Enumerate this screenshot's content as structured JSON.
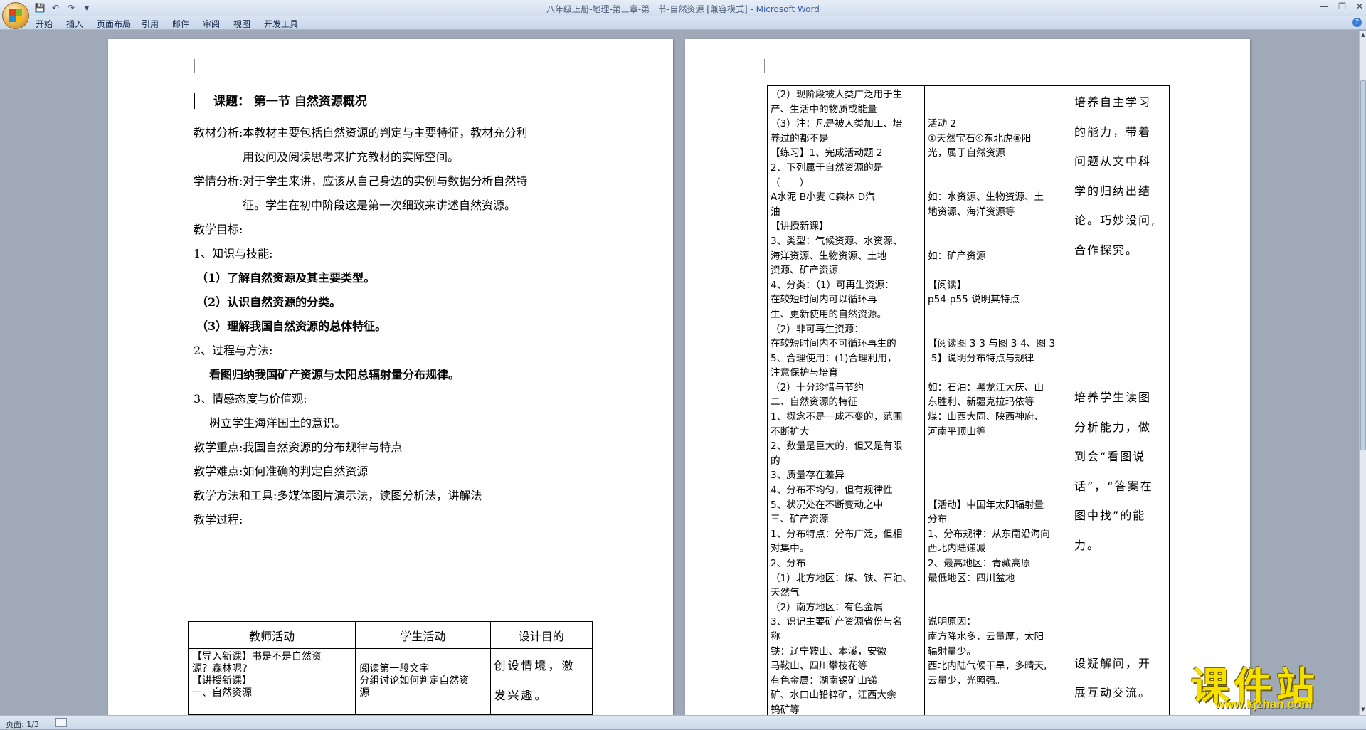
{
  "window": {
    "title": "八年级上册-地理-第三章-第一节-自然资源 [兼容模式]",
    "app_name": "Microsoft Word",
    "title_separator": " - "
  },
  "ribbon": {
    "tabs": [
      "开始",
      "插入",
      "页面布局",
      "引用",
      "邮件",
      "审阅",
      "视图",
      "开发工具"
    ]
  },
  "page1": {
    "title": "课题：  第一节  自然资源概况",
    "lines": [
      {
        "text": "教材分析:本教材主要包括自然资源的判定与主要特征，教材充分利",
        "bold": false
      },
      {
        "text": "用设问及阅读思考来扩充教材的实际空间。",
        "bold": false
      },
      {
        "text": "学情分析:对于学生来讲，应该从自己身边的实例与数据分析自然特",
        "bold": false
      },
      {
        "text": "征。学生在初中阶段这是第一次细致来讲述自然资源。",
        "bold": false
      },
      {
        "text": "教学目标:",
        "bold": false
      },
      {
        "text": "1、知识与技能:",
        "bold": false
      },
      {
        "text": "（1）了解自然资源及其主要类型。",
        "bold": true
      },
      {
        "text": "（2）认识自然资源的分类。",
        "bold": true
      },
      {
        "text": "（3）理解我国自然资源的总体特征。",
        "bold": true
      },
      {
        "text": "2、过程与方法:",
        "bold": false
      },
      {
        "text": "看图归纳我国矿产资源与太阳总辐射量分布规律。",
        "bold": true
      },
      {
        "text": "3、情感态度与价值观:",
        "bold": false
      },
      {
        "text": "树立学生海洋国土的意识。",
        "bold": false
      },
      {
        "text": "教学重点:我国自然资源的分布规律与特点",
        "bold": false
      },
      {
        "text": "教学难点:如何准确的判定自然资源",
        "bold": false
      },
      {
        "text": "教学方法和工具:多媒体图片演示法，读图分析法，讲解法",
        "bold": false
      },
      {
        "text": "教学过程:",
        "bold": false
      }
    ],
    "table": {
      "headers": [
        "教师活动",
        "学生活动",
        "设计目的"
      ],
      "col1": [
        "【导入新课】书是不是自然资",
        "源？森林呢?",
        "【讲授新课】",
        "一、自然资源"
      ],
      "col2": [
        "",
        "阅读第一段文字",
        "分组讨论如何判定自然资",
        "源"
      ],
      "col3": [
        "创设情境，激",
        "发兴趣。"
      ]
    }
  },
  "page2": {
    "col1": [
      "（2）现阶段被人类广泛用于生",
      "产、生活中的物质或能量",
      "（3）注：凡是被人类加工、培",
      "养过的都不是",
      "【练习】1、完成活动题 2",
      "2、下列属于自然资源的是",
      "（　　）",
      "A水泥  B小麦   C森林  D汽",
      "油",
      "【讲授新课】",
      "3、类型：气候资源、水资源、",
      "    海洋资源、生物资源、土地",
      "    资源、矿产资源",
      "4、分类：（1）可再生资源：",
      "    在较短时间内可以循环再",
      "    生、更新使用的自然资源。",
      "           （2）非可再生资源：",
      "在较短时间内不可循环再生的",
      "5、合理使用：(1)合理利用，",
      "    注意保护与培育",
      "（2）十分珍惜与节约",
      "二、自然资源的特征",
      "1、概念不是一成不变的，范围",
      "    不断扩大",
      "2、数量是巨大的，但又是有限",
      "    的",
      "3、质量存在差异",
      "4、分布不均匀，但有规律性",
      "5、状况处在不断变动之中",
      "三、矿产资源",
      "1、分布特点：分布广泛，但相",
      "    对集中。",
      "2、分布",
      "（1）北方地区：煤、铁、石油、",
      "天然气",
      "（2）南方地区：有色金属",
      "3、识记主要矿产资源省份与名",
      "称",
      "    铁：辽宁鞍山、本溪，安徽",
      "马鞍山、四川攀枝花等",
      "    有色金属：湖南锡矿山锑",
      "矿、水口山铅锌矿，江西大余",
      "钨矿等"
    ],
    "col2": [
      "",
      "",
      "活动 2",
      "①天然宝石④东北虎⑧阳",
      "光，属于自然资源",
      "",
      "",
      "如：水资源、生物资源、土",
      "地资源、海洋资源等",
      "",
      "",
      "如：矿产资源",
      "",
      "【阅读】",
      "p54-p55 说明其特点",
      "",
      "",
      "【阅读图 3-3 与图 3-4、图 3",
      "-5】说明分布特点与规律",
      "",
      "如：石油：黑龙江大庆、山",
      "东胜利、新疆克拉玛依等",
      "    煤：山西大同、陕西神府、",
      "河南平顶山等",
      "",
      "",
      "",
      "",
      "【活动】中国年太阳辐射量",
      "分布",
      "1、分布规律：从东南沿海向",
      "    西北内陆递减",
      "2、最高地区：青藏高原",
      "最低地区：四川盆地",
      "",
      "",
      "说明原因：",
      "南方降水多，云量厚，太阳",
      "辐射量少。",
      "西北内陆气候干旱，多晴天,",
      "云量少，光照强。"
    ],
    "col3": [
      "培养自主学习",
      "的能力，带着",
      "问题从文中科",
      "学的归纳出结",
      "论。巧妙设问,",
      "合作探究。",
      "",
      "",
      "",
      "",
      "培养学生读图",
      "分析能力，做",
      "到会“看图说",
      "话”，“答案在",
      "图中找”的能",
      "力。",
      "",
      "",
      "",
      "设疑解问，开",
      "展互动交流。"
    ]
  },
  "watermark": {
    "text": "课件站",
    "url": "www.kjzhan.com"
  },
  "statusbar": {
    "page": "页面: 1/3"
  },
  "colors": {
    "ribbon_bg": "#d3deed",
    "workspace_bg": "#9fa9b8",
    "title_app": "#3c62a8",
    "watermark": "#f7e000"
  }
}
